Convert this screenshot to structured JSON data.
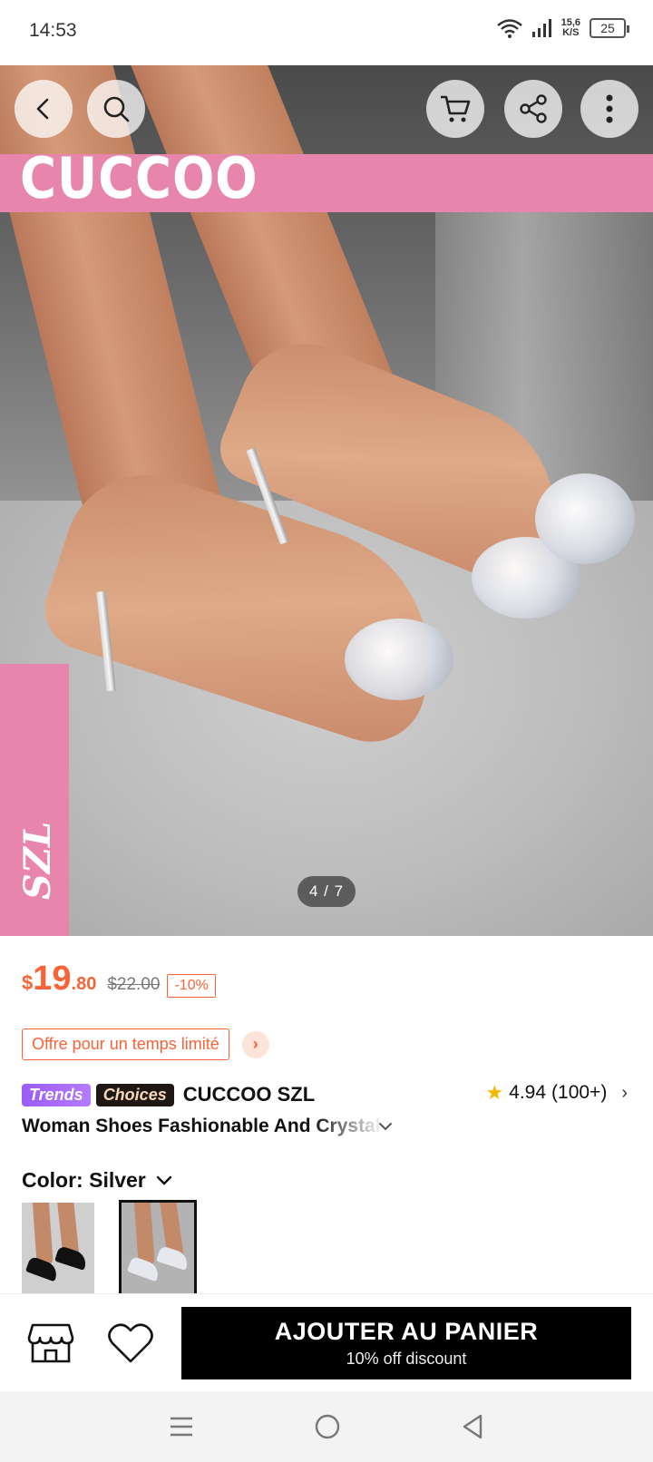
{
  "status_bar": {
    "time": "14:53",
    "speed_value": "15,6",
    "speed_unit": "K/S",
    "battery": "25"
  },
  "hero": {
    "brand_banner": "CUCCOO",
    "side_banner": "SZL",
    "page_indicator": "4 / 7",
    "brand_color": "#e885ad"
  },
  "price": {
    "currency": "$",
    "integer": "19",
    "decimal": ".80",
    "original": "$22.00",
    "discount": "-10%",
    "accent_color": "#fa6338"
  },
  "offer": {
    "label": "Offre pour un temps limité"
  },
  "product": {
    "tag_trends": "Trends",
    "tag_choices": "Choices",
    "brand": "CUCCOO SZL",
    "rating": "4.94",
    "rating_count": "(100+)",
    "title": "Woman Shoes Fashionable And Crystal"
  },
  "color": {
    "label": "Color: Silver"
  },
  "actions": {
    "cart_label": "AJOUTER AU PANIER",
    "cart_sub": "10% off discount"
  }
}
